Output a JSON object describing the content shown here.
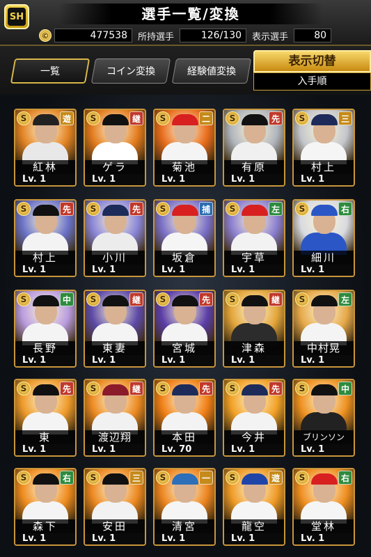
{
  "header": {
    "title": "選手一覧/変換",
    "coin_symbol": "©",
    "coins": "477538",
    "owned_label": "所持選手",
    "owned_value": "126/130",
    "display_label": "表示選手",
    "display_value": "80"
  },
  "tabs": [
    {
      "label": "一覧"
    },
    {
      "label": "コイン変換"
    },
    {
      "label": "経験値変換"
    }
  ],
  "toggle": {
    "title": "表示切替",
    "value": "入手順"
  },
  "players": [
    {
      "name": "紅林",
      "pos": "遊",
      "pos_color": "#c58a1a",
      "level": "Lv. 1",
      "bg": "#e38424",
      "uniform": "#e8e8e8",
      "cap": "#222"
    },
    {
      "name": "ゲラ",
      "pos": "継",
      "pos_color": "#c0392b",
      "level": "Lv. 1",
      "bg": "#e37b1d",
      "uniform": "#ffffff",
      "cap": "#111"
    },
    {
      "name": "菊池",
      "pos": "二",
      "pos_color": "#c58a1a",
      "level": "Lv. 1",
      "bg": "#e86c1c",
      "uniform": "#f4f4f4",
      "cap": "#d82020"
    },
    {
      "name": "有原",
      "pos": "先",
      "pos_color": "#c0392b",
      "level": "Lv. 1",
      "bg": "#b0b5bd",
      "uniform": "#f0f0f0",
      "cap": "#111"
    },
    {
      "name": "村上",
      "pos": "三",
      "pos_color": "#c58a1a",
      "level": "Lv. 1",
      "bg": "#c3c6cc",
      "uniform": "#f5f5f5",
      "cap": "#1d2b5a"
    },
    {
      "name": "村上",
      "pos": "先",
      "pos_color": "#c0392b",
      "level": "Lv. 1",
      "bg": "#6a73c8",
      "uniform": "#f3f3f3",
      "cap": "#111"
    },
    {
      "name": "小川",
      "pos": "先",
      "pos_color": "#c0392b",
      "level": "Lv. 1",
      "bg": "#8a86d8",
      "uniform": "#ececec",
      "cap": "#1d2b5a"
    },
    {
      "name": "坂倉",
      "pos": "捕",
      "pos_color": "#2b6cb0",
      "level": "Lv. 1",
      "bg": "#7a70c8",
      "uniform": "#f5f5f5",
      "cap": "#d82020"
    },
    {
      "name": "宇草",
      "pos": "左",
      "pos_color": "#2e8b3e",
      "level": "Lv. 1",
      "bg": "#8b7fd0",
      "uniform": "#f2f2f2",
      "cap": "#d82020"
    },
    {
      "name": "細川",
      "pos": "右",
      "pos_color": "#2e8b3e",
      "level": "Lv. 1",
      "bg": "#d8dae0",
      "uniform": "#2a56c6",
      "cap": "#2a56c6"
    },
    {
      "name": "長野",
      "pos": "中",
      "pos_color": "#2e8b3e",
      "level": "Lv. 1",
      "bg": "#b99cdf",
      "uniform": "#f4f4f4",
      "cap": "#111"
    },
    {
      "name": "東妻",
      "pos": "継",
      "pos_color": "#c0392b",
      "level": "Lv. 1",
      "bg": "#5d4aa8",
      "uniform": "#f4f4f4",
      "cap": "#111"
    },
    {
      "name": "宮城",
      "pos": "先",
      "pos_color": "#c0392b",
      "level": "Lv. 1",
      "bg": "#5b3ea8",
      "uniform": "#f4f4f4",
      "cap": "#111"
    },
    {
      "name": "津森",
      "pos": "継",
      "pos_color": "#c0392b",
      "level": "Lv. 1",
      "bg": "#e3a53a",
      "uniform": "#2c2c2c",
      "cap": "#111"
    },
    {
      "name": "中村晃",
      "pos": "左",
      "pos_color": "#2e8b3e",
      "level": "Lv. 1",
      "bg": "#e6a94a",
      "uniform": "#f4f4f4",
      "cap": "#111"
    },
    {
      "name": "東",
      "pos": "先",
      "pos_color": "#c0392b",
      "level": "Lv. 1",
      "bg": "#ee9a2a",
      "uniform": "#f4f4f4",
      "cap": "#111"
    },
    {
      "name": "渡辺翔",
      "pos": "継",
      "pos_color": "#c0392b",
      "level": "Lv. 1",
      "bg": "#ec8a22",
      "uniform": "#f1f1f1",
      "cap": "#8b1a2a"
    },
    {
      "name": "本田",
      "pos": "先",
      "pos_color": "#c0392b",
      "level": "Lv. 70",
      "bg": "#f07f16",
      "uniform": "#f3f3f3",
      "cap": "#1d2b5a"
    },
    {
      "name": "今井",
      "pos": "先",
      "pos_color": "#c0392b",
      "level": "Lv. 1",
      "bg": "#f2a126",
      "uniform": "#f3f3f3",
      "cap": "#1d2b5a"
    },
    {
      "name": "ブリンソン",
      "pos": "中",
      "pos_color": "#2e8b3e",
      "level": "Lv. 1",
      "bg": "#ee9120",
      "uniform": "#222222",
      "cap": "#111"
    },
    {
      "name": "森下",
      "pos": "右",
      "pos_color": "#2e8b3e",
      "level": "Lv. 1",
      "bg": "#ee8b1e",
      "uniform": "#f4f4f4",
      "cap": "#111"
    },
    {
      "name": "安田",
      "pos": "三",
      "pos_color": "#c58a1a",
      "level": "Lv. 1",
      "bg": "#ec8820",
      "uniform": "#f2f2f2",
      "cap": "#111"
    },
    {
      "name": "清宮",
      "pos": "一",
      "pos_color": "#c58a1a",
      "level": "Lv. 1",
      "bg": "#ec8520",
      "uniform": "#f5f5f5",
      "cap": "#2d6fb8"
    },
    {
      "name": "龍空",
      "pos": "遊",
      "pos_color": "#c58a1a",
      "level": "Lv. 1",
      "bg": "#ef9a26",
      "uniform": "#f5f5f5",
      "cap": "#2045a8"
    },
    {
      "name": "堂林",
      "pos": "右",
      "pos_color": "#2e8b3e",
      "level": "Lv. 1",
      "bg": "#ef8e20",
      "uniform": "#f5f5f5",
      "cap": "#d82020"
    }
  ]
}
